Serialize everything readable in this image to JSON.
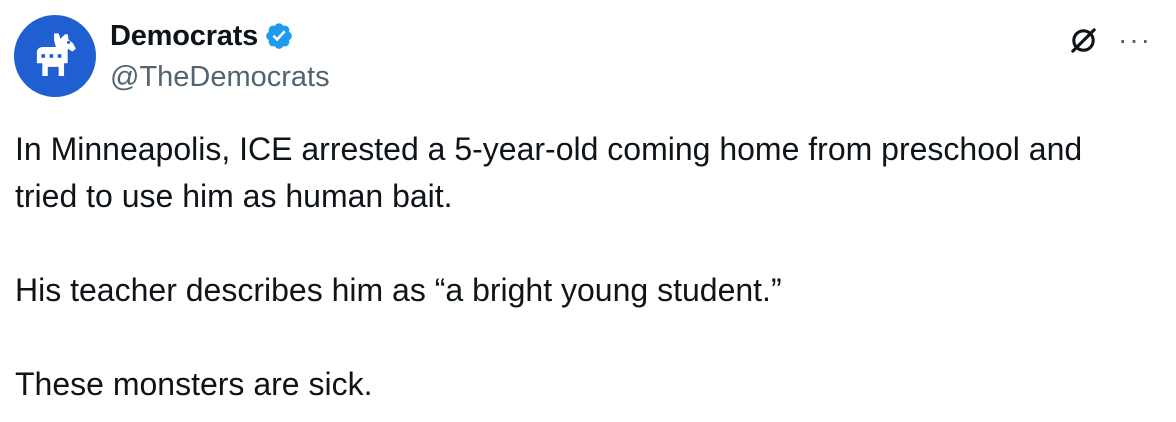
{
  "author": {
    "display_name": "Democrats",
    "handle": "@TheDemocrats",
    "verified": true,
    "avatar_icon": "democrat-donkey-icon",
    "avatar_color": "#1f5fd1",
    "verified_color": "#1d9bf0"
  },
  "actions": {
    "grok_icon": "grok-icon",
    "more_label": "···"
  },
  "tweet": {
    "paragraphs": [
      "In Minneapolis, ICE arrested a 5-year-old coming home from preschool and tried to use him as human bait.",
      "His teacher describes him as “a bright young student.”",
      "These monsters are sick."
    ]
  }
}
